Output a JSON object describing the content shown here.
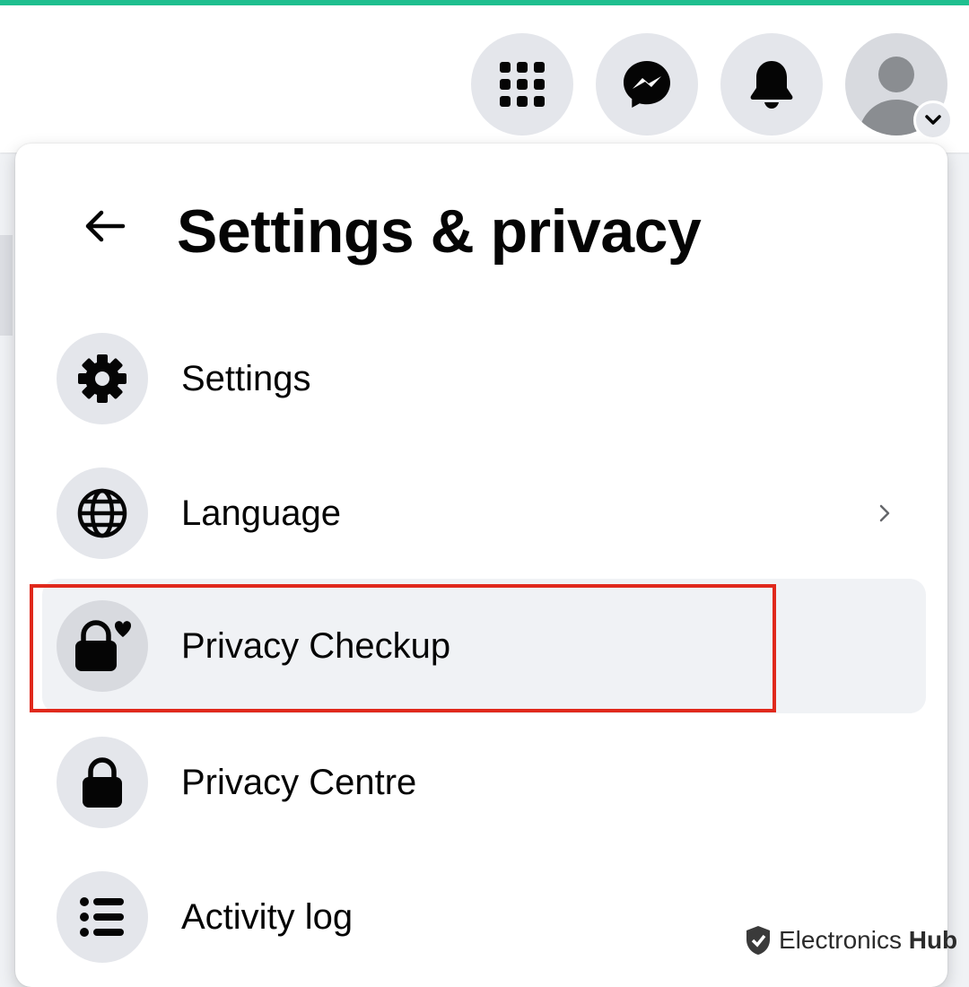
{
  "topbar": {
    "accent_color": "#1fbf8f",
    "buttons": [
      {
        "name": "menu",
        "icon": "grid-icon"
      },
      {
        "name": "messenger",
        "icon": "messenger-icon"
      },
      {
        "name": "notifications",
        "icon": "bell-icon"
      },
      {
        "name": "account",
        "icon": "avatar-icon",
        "badge_icon": "chevron-down-icon"
      }
    ]
  },
  "menu": {
    "title": "Settings & privacy",
    "back_icon": "arrow-left-icon",
    "items": [
      {
        "label": "Settings",
        "icon": "gear-icon",
        "has_chevron": false
      },
      {
        "label": "Language",
        "icon": "globe-icon",
        "has_chevron": true
      },
      {
        "label": "Privacy Checkup",
        "icon": "lock-heart-icon",
        "has_chevron": false,
        "hovered": true,
        "highlighted": true
      },
      {
        "label": "Privacy Centre",
        "icon": "lock-icon",
        "has_chevron": false
      },
      {
        "label": "Activity log",
        "icon": "list-icon",
        "has_chevron": false
      }
    ]
  },
  "highlight_color": "#e0291c",
  "watermark": {
    "text_regular": "Electronics",
    "text_bold": "Hub"
  }
}
